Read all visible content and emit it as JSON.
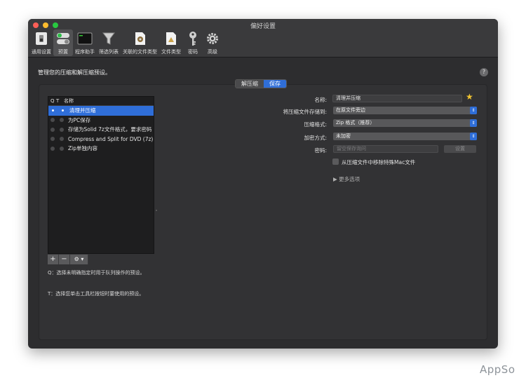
{
  "window": {
    "title": "偏好设置"
  },
  "toolbar": {
    "items": [
      {
        "label": "通用设置",
        "icon": "switch-icon"
      },
      {
        "label": "预置",
        "icon": "presets-icon"
      },
      {
        "label": "程序助手",
        "icon": "terminal-icon"
      },
      {
        "label": "筛选列表",
        "icon": "funnel-icon"
      },
      {
        "label": "关联的文件类型",
        "icon": "document-icon"
      },
      {
        "label": "文件类型",
        "icon": "filetype-icon"
      },
      {
        "label": "密码",
        "icon": "key-icon"
      },
      {
        "label": "高级",
        "icon": "gear-icon"
      }
    ]
  },
  "main": {
    "heading": "管理您的压缩和解压缩预设。",
    "help": "?",
    "tabs": [
      {
        "label": "解压缩"
      },
      {
        "label": "保存"
      }
    ]
  },
  "presets": {
    "headers": {
      "q": "Q",
      "t": "T",
      "name": "名称"
    },
    "rows": [
      {
        "name": "清理并压缩"
      },
      {
        "name": "为PC保存"
      },
      {
        "name": "存储为Solid 7z文件格式，要求密码"
      },
      {
        "name": "Compress and Split for DVD (7z)"
      },
      {
        "name": "Zip单独内容"
      }
    ],
    "buttons": {
      "add": "+",
      "remove": "−",
      "action": "⚙ ▾"
    }
  },
  "notes": {
    "q": "Q：选择未明确指定时用于队列操作的预设。",
    "t": "T：选择您单击工具栏按钮时要使用的预设。"
  },
  "form": {
    "name_label": "名称:",
    "name_value": "清理并压缩",
    "location_label": "将压缩文件存储到:",
    "location_value": "在原文件旁边",
    "format_label": "压缩格式:",
    "format_value": "Zip 格式（推荐）",
    "encryption_label": "加密方式:",
    "encryption_value": "未加密",
    "password_label": "密码:",
    "password_placeholder": "留空保存询问",
    "set_button": "设置",
    "remove_mac_label": "从压缩文件中移除特殊Mac文件",
    "more_options": "▶ 更多选项"
  },
  "watermark": "AppSo"
}
